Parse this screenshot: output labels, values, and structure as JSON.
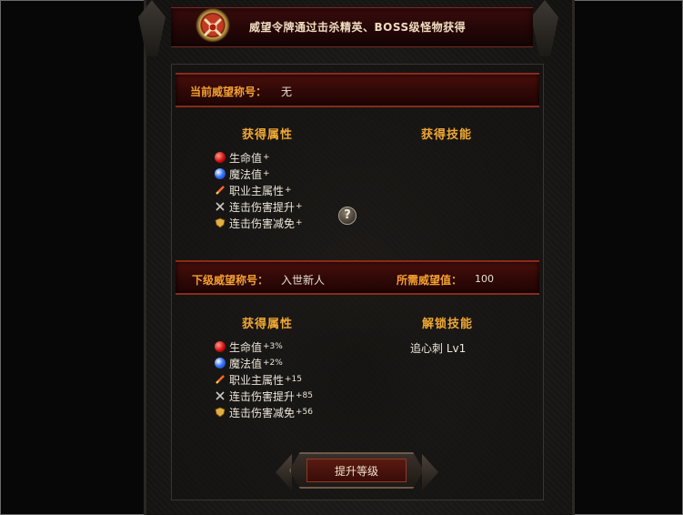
{
  "banner": {
    "title": "威望令牌通过击杀精英、BOSS级怪物获得"
  },
  "current": {
    "title_label": "当前威望称号：",
    "title_value": "无",
    "attrs_header": "获得属性",
    "skills_header": "获得技能",
    "attrs": [
      {
        "icon": "health-orb-icon",
        "label": "生命值",
        "value": "+"
      },
      {
        "icon": "mana-orb-icon",
        "label": "魔法值",
        "value": "+"
      },
      {
        "icon": "sword-icon",
        "label": "职业主属性",
        "value": "+"
      },
      {
        "icon": "crossed-swords-icon",
        "label": "连击伤害提升",
        "value": "+"
      },
      {
        "icon": "shield-icon",
        "label": "连击伤害减免",
        "value": "+"
      }
    ],
    "help_symbol": "?"
  },
  "next": {
    "title_label": "下级威望称号：",
    "title_value": "入世新人",
    "required_label": "所需威望值：",
    "required_value": "100",
    "attrs_header": "获得属性",
    "skills_header": "解锁技能",
    "attrs": [
      {
        "icon": "health-orb-icon",
        "label": "生命值",
        "value": "+3%"
      },
      {
        "icon": "mana-orb-icon",
        "label": "魔法值",
        "value": "+2%"
      },
      {
        "icon": "sword-icon",
        "label": "职业主属性",
        "value": "+15"
      },
      {
        "icon": "crossed-swords-icon",
        "label": "连击伤害提升",
        "value": "+85"
      },
      {
        "icon": "shield-icon",
        "label": "连击伤害减免",
        "value": "+56"
      }
    ],
    "skill": "追心刺 Lv1"
  },
  "upgrade_button": {
    "label": "提升等级"
  },
  "colors": {
    "accent": "#f0a834",
    "bar": "#2e0806",
    "text": "#ece6da"
  }
}
